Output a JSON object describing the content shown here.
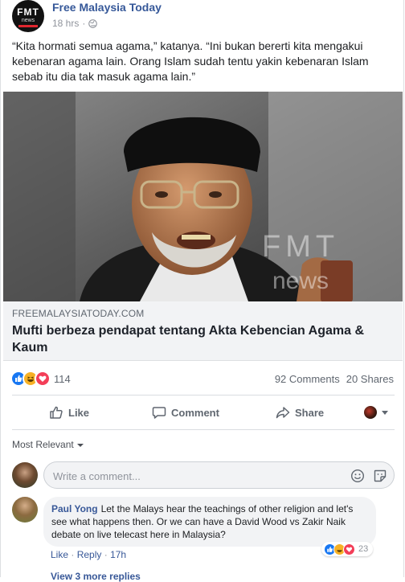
{
  "post": {
    "page_name": "Free Malaysia Today",
    "time": "18 hrs",
    "meta_separator": "·",
    "text": "“Kita hormati semua agama,” katanya. “Ini bukan bererti kita mengakui kebenaran agama lain. Orang Islam sudah tentu yakin kebenaran Islam sebab itu dia tak masuk agama lain.”"
  },
  "logo": {
    "top": "FMT",
    "bottom": "news"
  },
  "photo": {
    "watermark_top": "FMT",
    "watermark_bottom": "news"
  },
  "link": {
    "domain": "FREEMALAYSIATODAY.COM",
    "title": "Mufti berbeza pendapat tentang Akta Kebencian Agama & Kaum"
  },
  "reactions": {
    "types": [
      "like",
      "haha",
      "love"
    ],
    "count": "114",
    "comments": "92 Comments",
    "shares": "20 Shares"
  },
  "actions": {
    "like": "Like",
    "comment": "Comment",
    "share": "Share"
  },
  "comments": {
    "sort_label": "Most Relevant",
    "write_placeholder": "Write a comment...",
    "items": [
      {
        "author": "Paul Yong",
        "text": "Let the Malays hear the teachings of other religion and let's see what happens then. Or we can have a David Wood vs Zakir Naik debate on live telecast here in Malaysia?",
        "reaction_count": "23",
        "like_label": "Like",
        "reply_label": "Reply",
        "time": "17h",
        "separator": "·"
      }
    ],
    "more_replies": "View 3 more replies"
  },
  "colors": {
    "link_blue": "#365899",
    "muted": "#606770",
    "like": "#1877f2",
    "love": "#f33e58",
    "haha": "#f7b125"
  }
}
